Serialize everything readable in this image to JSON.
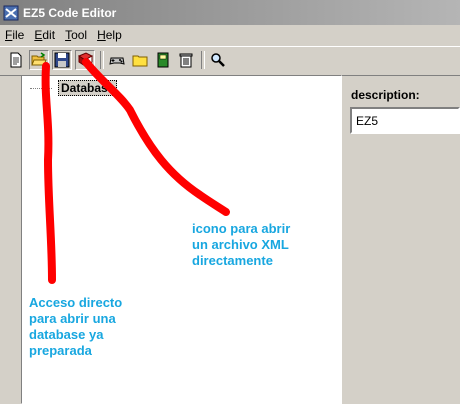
{
  "window": {
    "title": "EZ5 Code Editor"
  },
  "menu": {
    "items": [
      {
        "accel": "F",
        "rest": "ile"
      },
      {
        "accel": "E",
        "rest": "dit"
      },
      {
        "accel": "T",
        "rest": "ool"
      },
      {
        "accel": "H",
        "rest": "elp"
      }
    ]
  },
  "toolbar": {
    "buttons": [
      "new-document-icon",
      "open-folder-icon",
      "save-disk-icon",
      "open-database-book-icon",
      "gamepad-icon",
      "folder-icon",
      "green-book-icon",
      "trash-icon",
      "search-icon"
    ]
  },
  "tree": {
    "root_label": "Database"
  },
  "properties": {
    "description_label": "description:",
    "description_value": "EZ5"
  },
  "annotations": {
    "xml_note": [
      "icono para abrir",
      "un archivo XML",
      "directamente"
    ],
    "db_note": [
      "Acceso directo",
      "para abrir una",
      "database ya",
      "preparada"
    ],
    "color": "#18a7e0",
    "stroke_color": "#ff0000"
  }
}
